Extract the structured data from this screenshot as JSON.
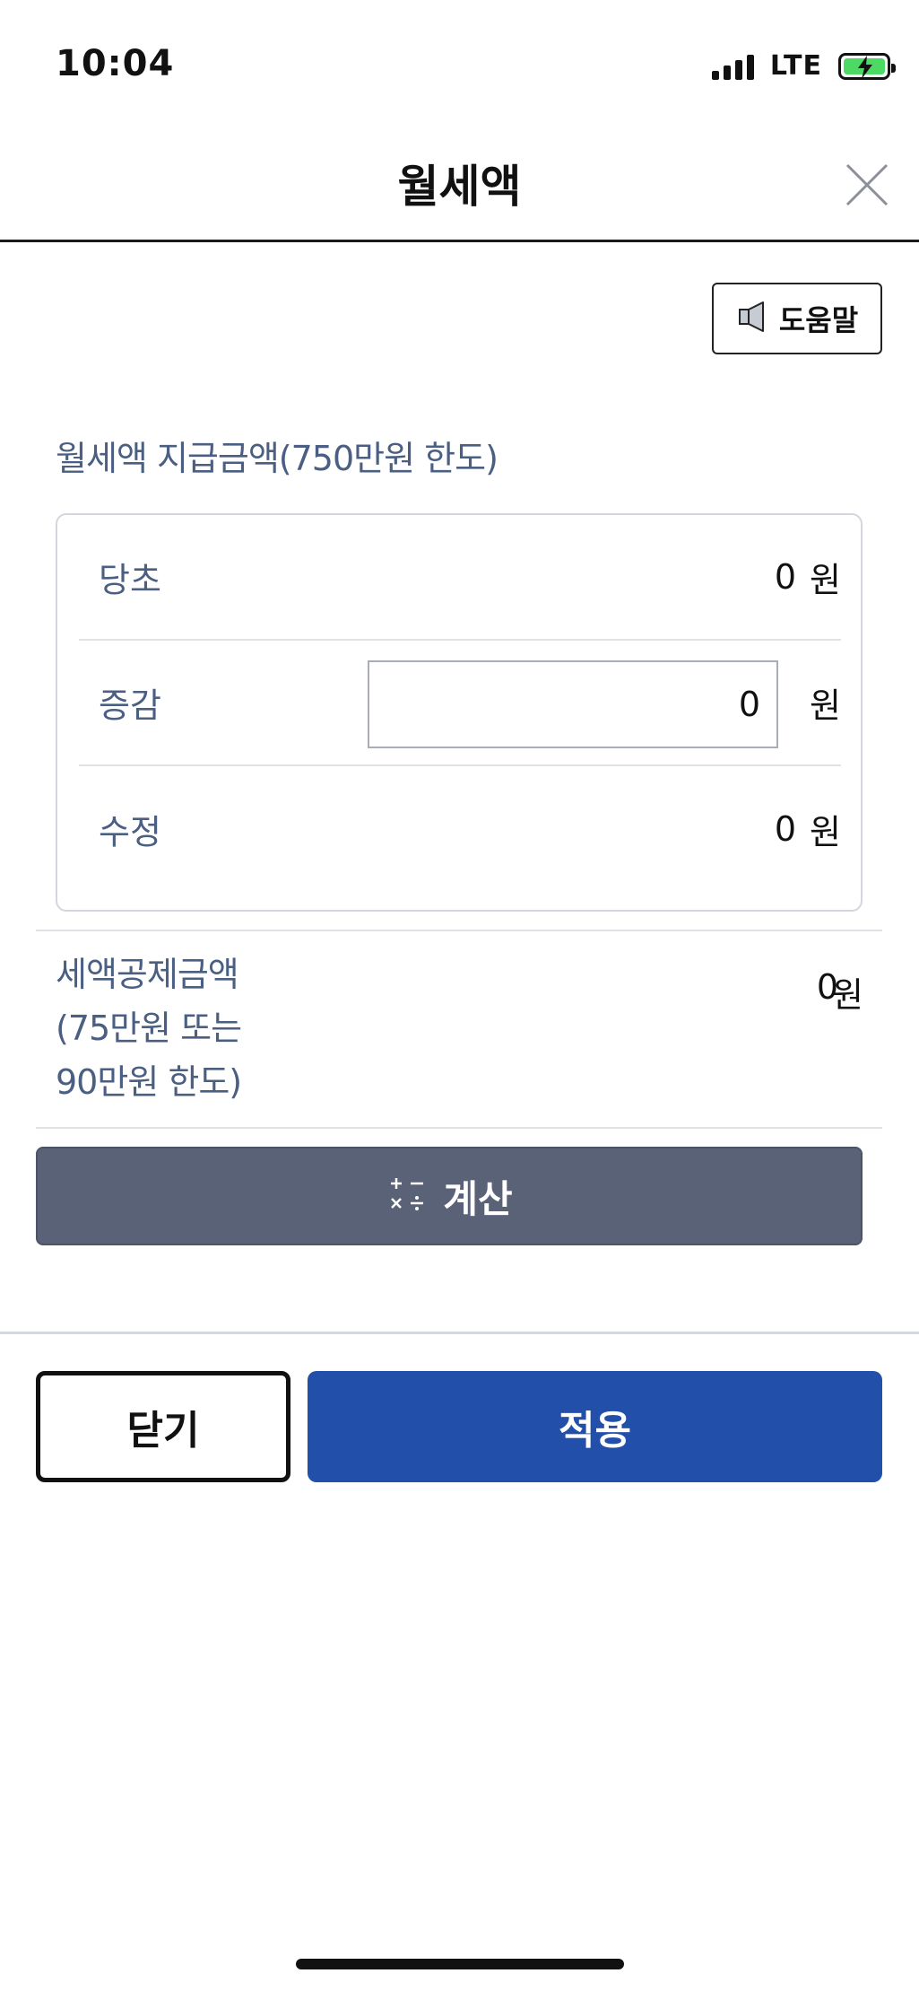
{
  "status_bar": {
    "time": "10:04",
    "network": "LTE"
  },
  "header": {
    "title": "월세액",
    "close_icon": "close-icon"
  },
  "help_button": {
    "label": "도움말",
    "icon": "speaker-icon"
  },
  "section": {
    "title": "월세액 지급금액(750만원 한도)",
    "rows": [
      {
        "label": "당초",
        "value": "0",
        "unit": "원"
      },
      {
        "label": "증감",
        "value": "0",
        "unit": "원"
      },
      {
        "label": "수정",
        "value": "0",
        "unit": "원"
      }
    ]
  },
  "deduction": {
    "label_line1": "세액공제금액",
    "label_line2": "(75만원 또는",
    "label_line3": "90만원 한도)",
    "value": "0",
    "unit": "원"
  },
  "calc_button": {
    "label": "계산",
    "icon": "calculator-icon"
  },
  "footer": {
    "close_label": "닫기",
    "apply_label": "적용"
  },
  "colors": {
    "label_blue": "#4a5f82",
    "calc_button": "#5a6278",
    "apply_button": "#224faa"
  }
}
